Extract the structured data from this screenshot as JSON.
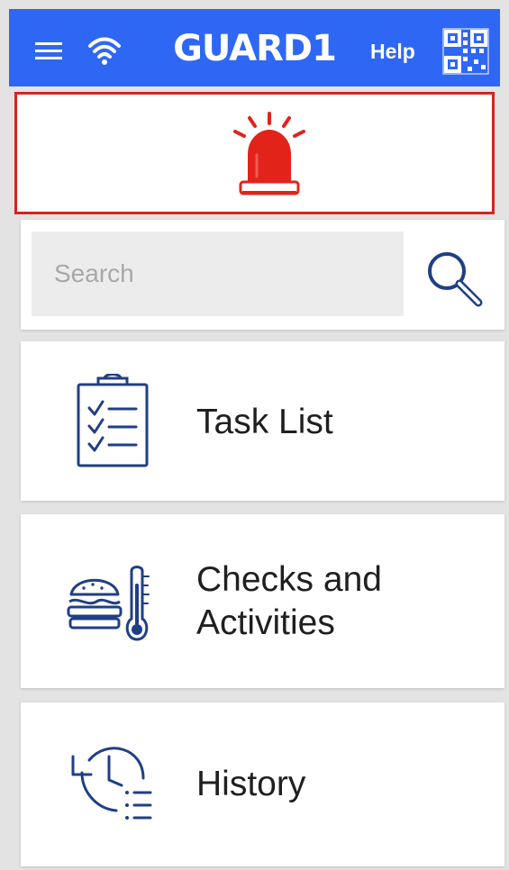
{
  "app": {
    "brand": "GUARD1",
    "help_label": "Help"
  },
  "icons": {
    "menu": "menu-icon",
    "wifi": "wifi-icon",
    "qr": "qr-code-icon",
    "alarm": "alarm-light-icon",
    "search": "search-icon",
    "task_list": "clipboard-checklist-icon",
    "checks": "meal-thermometer-icon",
    "history": "history-clock-icon"
  },
  "colors": {
    "header": "#2f67f5",
    "alarm": "#e2231a",
    "icon": "#1f3f86",
    "text": "#1f1f1f"
  },
  "search": {
    "placeholder": "Search",
    "value": ""
  },
  "tiles": [
    {
      "label": "Task List"
    },
    {
      "label": "Checks and\nActivities"
    },
    {
      "label": "History"
    }
  ]
}
